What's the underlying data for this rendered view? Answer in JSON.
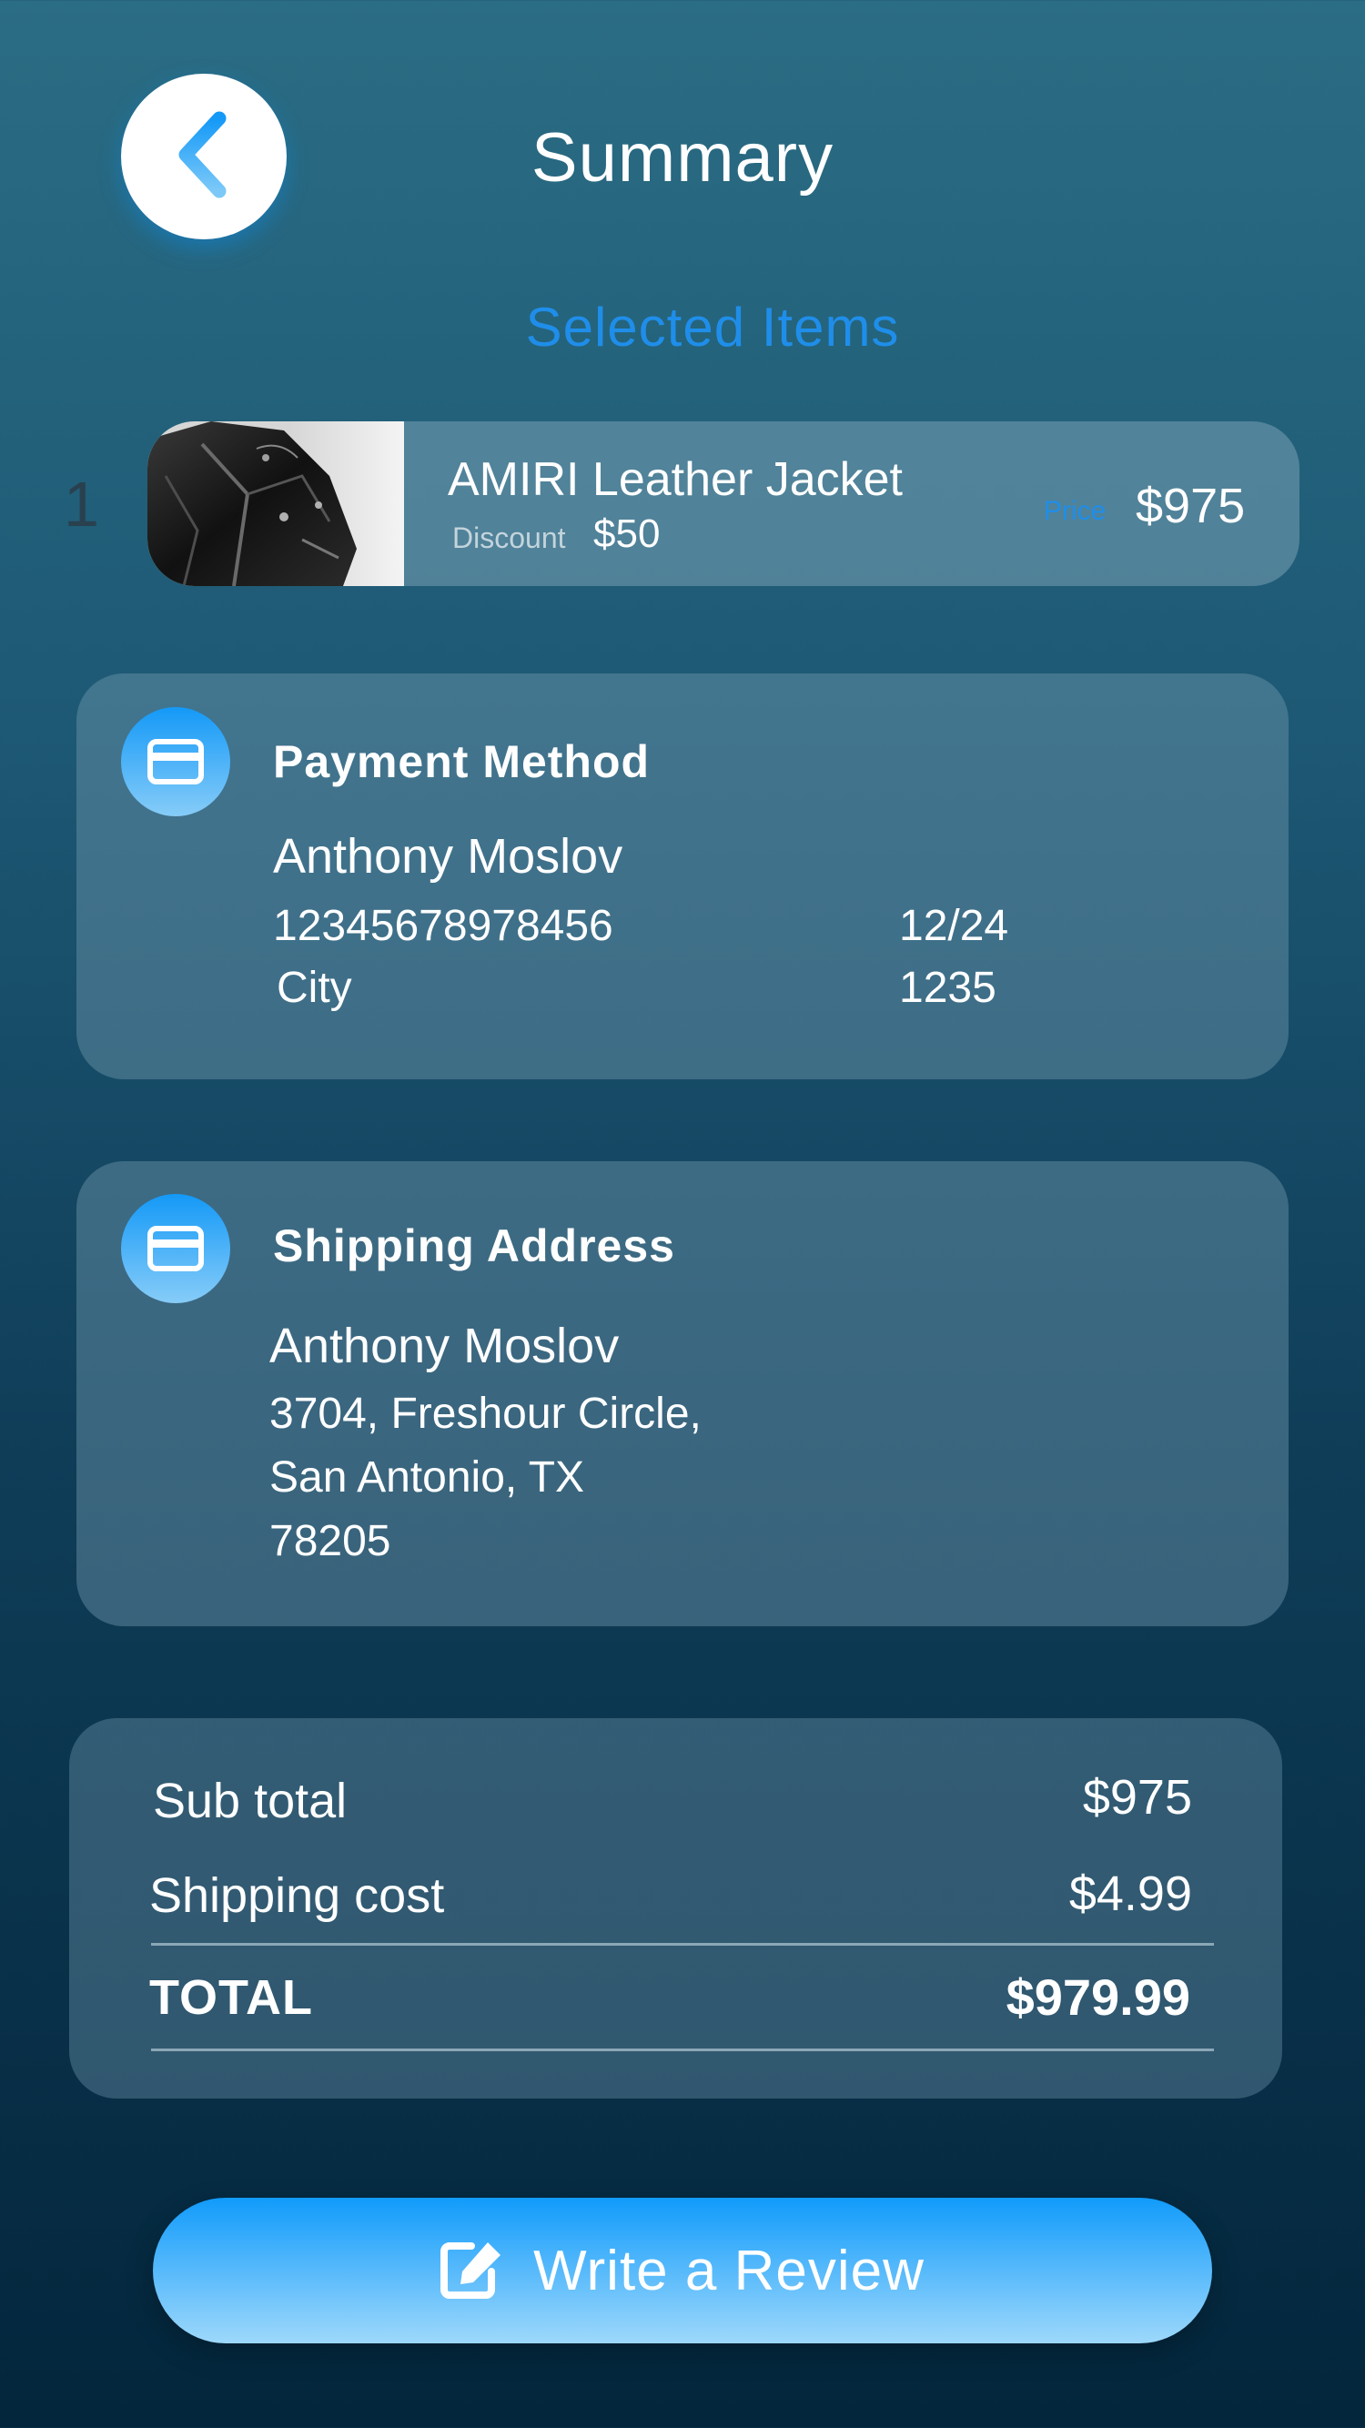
{
  "header": {
    "title": "Summary",
    "back_icon": "chevron-left-icon"
  },
  "selected_items": {
    "heading": "Selected Items",
    "items": [
      {
        "index": "1",
        "name": "AMIRI Leather Jacket",
        "discount_label": "Discount",
        "discount_value": "$50",
        "price_label": "Price",
        "price_value": "$975",
        "thumbnail": "leather-jacket-photo"
      }
    ]
  },
  "payment": {
    "icon": "credit-card-icon",
    "title": "Payment Method",
    "name": "Anthony Moslov",
    "card_number": "12345678978456",
    "expiry": "12/24",
    "city": "City",
    "code": "1235"
  },
  "shipping": {
    "icon": "credit-card-icon",
    "title": "Shipping Address",
    "name": "Anthony Moslov",
    "line1": "3704, Freshour Circle,",
    "line2": "San Antonio, TX",
    "line3": "78205"
  },
  "totals": {
    "subtotal_label": "Sub total",
    "subtotal_value": "$975",
    "shipping_label": "Shipping cost",
    "shipping_value": "$4.99",
    "total_label": "TOTAL",
    "total_value": "$979.99"
  },
  "review_button": {
    "label": "Write a Review",
    "icon": "edit-icon"
  },
  "colors": {
    "accent": "#1f8eea",
    "button_top": "#119bfb",
    "button_bottom": "#9dd8fb",
    "background_top": "#2b6d84",
    "background_bottom": "#03263c"
  }
}
